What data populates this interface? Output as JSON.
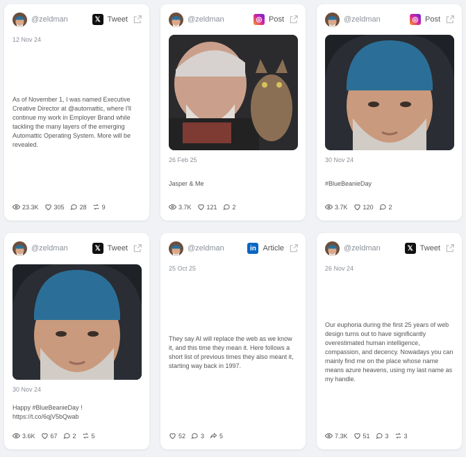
{
  "cards": [
    {
      "handle": "@zeldman",
      "platform": "Tweet",
      "date": "12 Nov 24",
      "text": "As of November 1, I was named Executive Creative Director at @automattic, where I'll continue my work in Employer Brand while tackling the many layers of the emerging Automattic Operating System. More will be revealed.",
      "stats": {
        "views": "23.3K",
        "likes": "305",
        "replies": "28",
        "reposts": "9"
      }
    },
    {
      "handle": "@zeldman",
      "platform": "Post",
      "date": "26 Feb 25",
      "text": "Jasper & Me",
      "stats": {
        "views": "3.7K",
        "likes": "121",
        "replies": "2"
      }
    },
    {
      "handle": "@zeldman",
      "platform": "Post",
      "date": "30 Nov 24",
      "text": "#BlueBeanieDay",
      "stats": {
        "views": "3.7K",
        "likes": "120",
        "replies": "2"
      }
    },
    {
      "handle": "@zeldman",
      "platform": "Tweet",
      "date": "30 Nov 24",
      "text_line1": "Happy #BlueBeanieDay !",
      "text_line2": "https://t.co/6qjV5bQwab",
      "stats": {
        "views": "3.6K",
        "likes": "67",
        "replies": "2",
        "reposts": "5"
      }
    },
    {
      "handle": "@zeldman",
      "platform": "Article",
      "date": "25 Oct 25",
      "text": "They say AI will replace the web as we know it, and this time they mean it. Here follows a short list of previous times they also meant it, starting way back in 1997.",
      "stats": {
        "likes": "52",
        "replies": "3",
        "shares": "5"
      }
    },
    {
      "handle": "@zeldman",
      "platform": "Tweet",
      "date": "26 Nov 24",
      "text": "Our euphoria during the first 25 years of web design turns out to have significantly overestimated human intelligence, compassion, and decency. Nowadays you can mainly find me on the place whose name means azure heavens, using my last name as my handle.",
      "stats": {
        "views": "7.3K",
        "likes": "51",
        "replies": "3",
        "reposts": "3"
      }
    }
  ],
  "colors": {
    "x_icon": "#111111",
    "instagram_icon": "#d6249f",
    "linkedin_icon": "#0a66c2",
    "beanie": "#2b6f98"
  }
}
